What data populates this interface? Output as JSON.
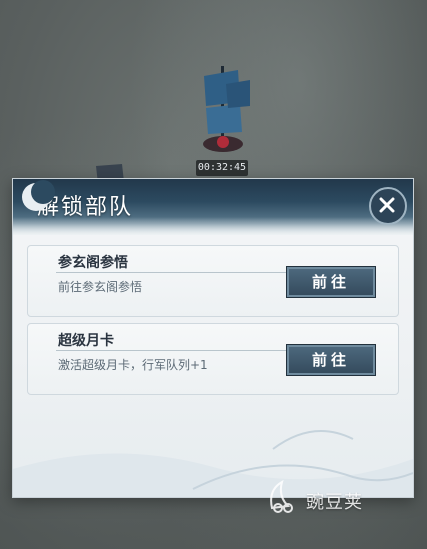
{
  "map": {
    "ship_timer": "00:32:45"
  },
  "dialog": {
    "title": "解锁部队",
    "close_icon": "close-icon",
    "tasks": [
      {
        "title": "参玄阁参悟",
        "description": "前往参玄阁参悟",
        "button_label": "前往"
      },
      {
        "title": "超级月卡",
        "description": "激活超级月卡，行军队列+1",
        "button_label": "前往"
      }
    ]
  },
  "watermark": {
    "text": "豌豆荚"
  },
  "colors": {
    "header_dark": "#22384b",
    "button": "#3f586b",
    "panel": "#eef1f3"
  }
}
